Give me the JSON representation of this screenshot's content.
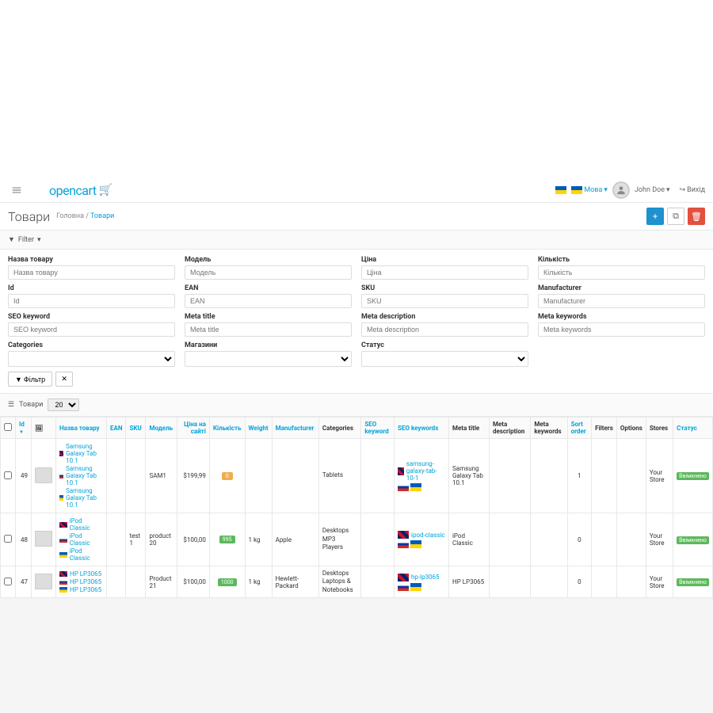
{
  "header": {
    "logo_text": "opencart",
    "lang_label": "Мова",
    "user_name": "John Doe",
    "logout": "Вихід"
  },
  "title": {
    "page": "Товари",
    "bc_home": "Головна",
    "bc_current": "Товари"
  },
  "filter": {
    "toggle": "Filter",
    "labels": {
      "name": "Назва товару",
      "model": "Модель",
      "price": "Ціна",
      "qty": "Кількість",
      "id": "Id",
      "ean": "EAN",
      "sku": "SKU",
      "manufacturer": "Manufacturer",
      "seo": "SEO keyword",
      "meta_title": "Meta title",
      "meta_desc": "Meta description",
      "meta_kw": "Meta keywords",
      "categories": "Categories",
      "stores": "Магазини",
      "status": "Статус"
    },
    "placeholders": {
      "name": "Назва товару",
      "model": "Модель",
      "price": "Ціна",
      "qty": "Кількість",
      "id": "Id",
      "ean": "EAN",
      "sku": "SKU",
      "manufacturer": "Manufacturer",
      "seo": "SEO keyword",
      "meta_title": "Meta title",
      "meta_desc": "Meta description",
      "meta_kw": "Meta keywords"
    },
    "btn_filter": "Фільтр"
  },
  "list": {
    "title": "Товари",
    "page_size": "20"
  },
  "columns": {
    "id": "Id",
    "img": "",
    "name": "Назва товару",
    "ean": "EAN",
    "sku": "SKU",
    "model": "Модель",
    "price": "Ціна на сайті",
    "qty": "Кількість",
    "weight": "Weight",
    "manufacturer": "Manufacturer",
    "categories": "Categories",
    "seo_keyword": "SEO keyword",
    "seo_keywords": "SEO keywords",
    "meta_title": "Meta title",
    "meta_desc": "Meta description",
    "meta_kw": "Meta keywords",
    "sort": "Sort order",
    "filters": "Filters",
    "options": "Options",
    "stores": "Stores",
    "status": "Статус"
  },
  "rows": [
    {
      "id": "49",
      "names": [
        "Samsung Galaxy Tab 10.1",
        "Samsung Galaxy Tab 10.1",
        "Samsung Galaxy Tab 10.1"
      ],
      "ean": "",
      "sku": "",
      "model": "SAM1",
      "price": "$199,99",
      "qty": "0",
      "qty_style": "warn",
      "weight": "",
      "manufacturer": "",
      "categories": "Tablets",
      "seo_kw": "samsung-galaxy-tab-10-1",
      "meta_title": "Samsung Galaxy Tab 10.1",
      "sort": "1",
      "store": "Your Store",
      "status": "Ввімкнено",
      "thumb": "tablet"
    },
    {
      "id": "48",
      "names": [
        "iPod Classic",
        "iPod Classic",
        "iPod Classic"
      ],
      "ean": "",
      "sku": "test 1",
      "model": "product 20",
      "price": "$100,00",
      "qty": "995",
      "qty_style": "ok",
      "weight": "1 kg",
      "manufacturer": "Apple",
      "categories": "Desktops\nMP3 Players",
      "seo_kw": "ipod-classic",
      "meta_title": "iPod Classic",
      "sort": "0",
      "store": "Your Store",
      "status": "Ввімкнено",
      "thumb": "ipod"
    },
    {
      "id": "47",
      "names": [
        "HP LP3065",
        "HP LP3065",
        "HP LP3065"
      ],
      "ean": "",
      "sku": "",
      "model": "Product 21",
      "price": "$100,00",
      "qty": "1000",
      "qty_style": "ok",
      "weight": "1 kg",
      "manufacturer": "Hewlett-Packard",
      "categories": "Desktops\nLaptops & Notebooks",
      "seo_kw": "hp-lp3065",
      "meta_title": "HP LP3065",
      "sort": "0",
      "store": "Your Store",
      "status": "Ввімкнено",
      "thumb": "laptop"
    }
  ]
}
